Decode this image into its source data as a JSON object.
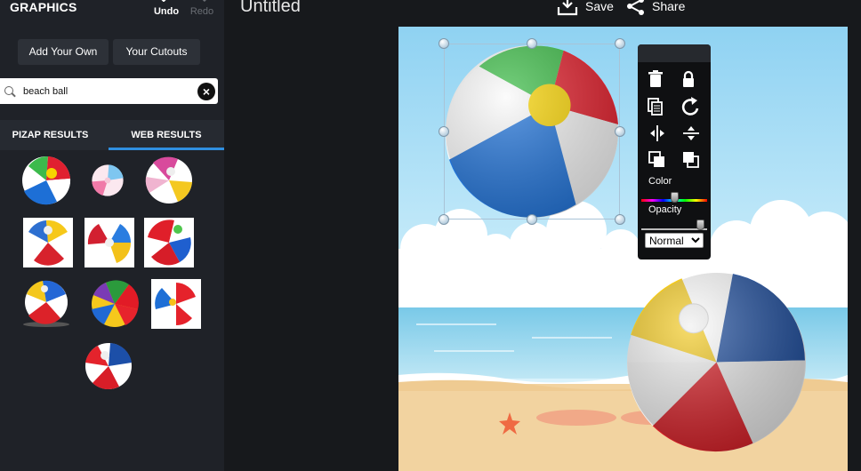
{
  "panel": {
    "title": "GRAPHICS",
    "undo_label": "Undo",
    "redo_label": "Redo",
    "add_own_label": "Add Your Own",
    "cutouts_label": "Your Cutouts",
    "search": {
      "value": "beach ball",
      "clear_icon": "close-circle-icon"
    },
    "tabs": [
      {
        "label": "PIZAP RESULTS",
        "active": false
      },
      {
        "label": "WEB RESULTS",
        "active": true
      }
    ],
    "result_count": 10
  },
  "topbar": {
    "doc_title": "Untitled",
    "save_label": "Save",
    "share_label": "Share"
  },
  "toolbar": {
    "color_label": "Color",
    "opacity_label": "Opacity",
    "color_value": 0.5,
    "opacity_value": 0.95,
    "blend_mode": "Normal",
    "blend_options": [
      "Normal"
    ],
    "icons": [
      "trash-icon",
      "lock-icon",
      "duplicate-icon",
      "rotate-icon",
      "flip-horizontal-icon",
      "flip-vertical-icon",
      "bring-forward-icon",
      "send-backward-icon"
    ]
  },
  "colors": {
    "accent": "#2f8fe0",
    "panel_bg": "#1f2228",
    "app_bg": "#17191c",
    "sky": "#bfe6f8",
    "sand": "#f2d3a0"
  }
}
